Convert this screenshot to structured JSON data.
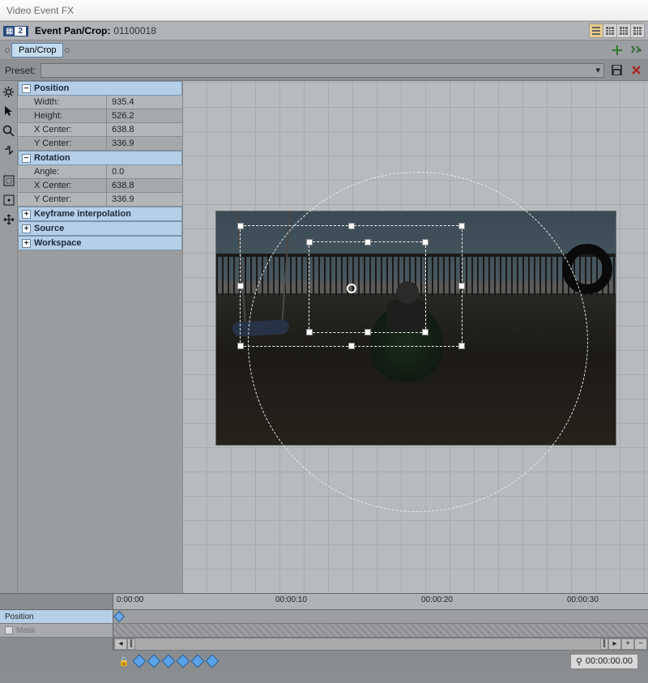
{
  "window": {
    "title": "Video Event FX"
  },
  "header": {
    "badge_num": "2",
    "label": "Event Pan/Crop:",
    "value": "01100018"
  },
  "tabs": {
    "active": "Pan/Crop"
  },
  "preset": {
    "label": "Preset:",
    "value": ""
  },
  "properties": {
    "sections": {
      "position": {
        "title": "Position",
        "rows": [
          {
            "name": "Width:",
            "value": "935.4"
          },
          {
            "name": "Height:",
            "value": "526.2"
          },
          {
            "name": "X Center:",
            "value": "638.8"
          },
          {
            "name": "Y Center:",
            "value": "336.9"
          }
        ]
      },
      "rotation": {
        "title": "Rotation",
        "rows": [
          {
            "name": "Angle:",
            "value": "0.0"
          },
          {
            "name": "X Center:",
            "value": "638.8"
          },
          {
            "name": "Y Center:",
            "value": "336.9"
          }
        ]
      },
      "keyframe": {
        "title": "Keyframe interpolation"
      },
      "source": {
        "title": "Source"
      },
      "workspace": {
        "title": "Workspace"
      }
    }
  },
  "timeline": {
    "ruler": [
      "0:00:00",
      "00:00:10",
      "00:00:20",
      "00:00:30"
    ],
    "tracks": [
      {
        "label": "Position",
        "active": true
      },
      {
        "label": "Mask",
        "active": false
      }
    ],
    "timecode": "00:00:00.00"
  }
}
